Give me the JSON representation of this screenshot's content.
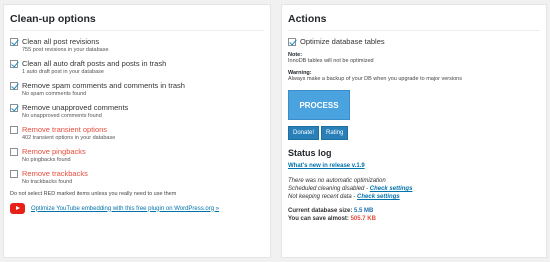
{
  "cleanup": {
    "title": "Clean-up options",
    "options": [
      {
        "label": "Clean all post revisions",
        "desc": "755 post revisions in your database",
        "checked": true,
        "red": false
      },
      {
        "label": "Clean all auto draft posts and posts in trash",
        "desc": "1 auto draft post in your database",
        "checked": true,
        "red": false
      },
      {
        "label": "Remove spam comments and comments in trash",
        "desc": "No spam comments found",
        "checked": true,
        "red": false
      },
      {
        "label": "Remove unapproved comments",
        "desc": "No unapproved comments found",
        "checked": true,
        "red": false
      },
      {
        "label": "Remove transient options",
        "desc": "402 transient options in your database",
        "checked": false,
        "red": true
      },
      {
        "label": "Remove pingbacks",
        "desc": "No pingbacks found",
        "checked": false,
        "red": true
      },
      {
        "label": "Remove trackbacks",
        "desc": "No trackbacks found",
        "checked": false,
        "red": true
      }
    ],
    "warning": "Do not select RED marked items unless you really need to use them",
    "youtube_link": "Optimize YouTube embedding with this free plugin on WordPress.org »"
  },
  "actions": {
    "title": "Actions",
    "optimize_label": "Optimize database tables",
    "note_title": "Note:",
    "note_text": "InnoDB tables will not be optimized",
    "warning_title": "Warning:",
    "warning_text": "Always make a backup of your DB when you upgrade to major versions",
    "process_label": "PROCESS",
    "donate_label": "Donate!",
    "rating_label": "Rating"
  },
  "status": {
    "title": "Status log",
    "whats_new": "What's new in release v.1.9",
    "line1": "There was no automatic optimization",
    "line2_prefix": "Scheduled cleaning disabled - ",
    "line2_link": "Check settings",
    "line3_prefix": "Not keeping recent data - ",
    "line3_link": "Check settings",
    "db_size_label": "Current database size: ",
    "db_size_value": "5.5 MB",
    "save_label": "You can save almost: ",
    "save_value": "505.7 KB"
  },
  "colors": {
    "link": "#0073aa",
    "red": "#e74c3c",
    "button": "#2980b9",
    "process": "#4aa3df"
  }
}
